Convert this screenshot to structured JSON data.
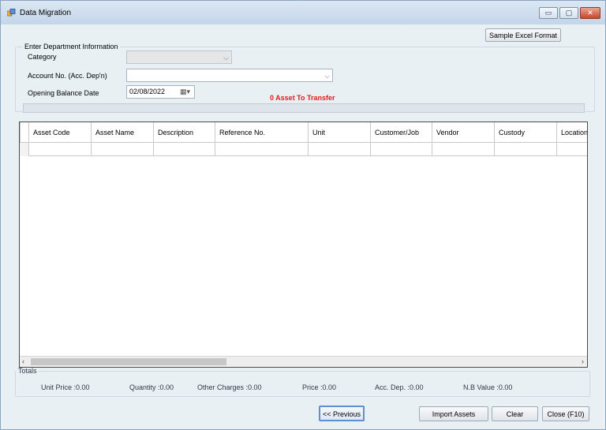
{
  "window": {
    "title": "Data Migration",
    "buttons": {
      "minimize": "▭",
      "maximize": "▢",
      "close": "✕"
    }
  },
  "toolbar": {
    "sample_excel_label": "Sample Excel Format"
  },
  "department": {
    "legend": "Enter Department Information",
    "category_label": "Category",
    "category_value": "",
    "account_label": "Account No. (Acc. Dep'n)",
    "account_value": "",
    "opening_date_label": "Opening Balance Date",
    "opening_date_value": "02/08/2022",
    "transfer_status": "0 Asset To Transfer"
  },
  "grid": {
    "columns": [
      "Asset Code",
      "Asset Name",
      "Description",
      "Reference No.",
      "Unit",
      "Customer/Job",
      "Vendor",
      "Custody",
      "Location"
    ]
  },
  "totals": {
    "legend": "Totals",
    "unit_price": "Unit Price :0.00",
    "quantity": "Quantity :0.00",
    "other_charges": "Other Charges :0.00",
    "price": "Price :0.00",
    "acc_dep": "Acc. Dep. :0.00",
    "nb_value": "N.B Value :0.00"
  },
  "footer": {
    "previous_label": "<< Previous",
    "import_label": "Import Assets",
    "clear_label": "Clear",
    "close_label": "Close (F10)"
  },
  "colors": {
    "accent": "#5e8fd0",
    "status_red": "#e21b1b",
    "titlebar": "#c4d6ea"
  },
  "icons": [
    "app-icon",
    "chevron-down-icon",
    "calendar-icon",
    "scroll-left-icon",
    "scroll-right-icon"
  ]
}
